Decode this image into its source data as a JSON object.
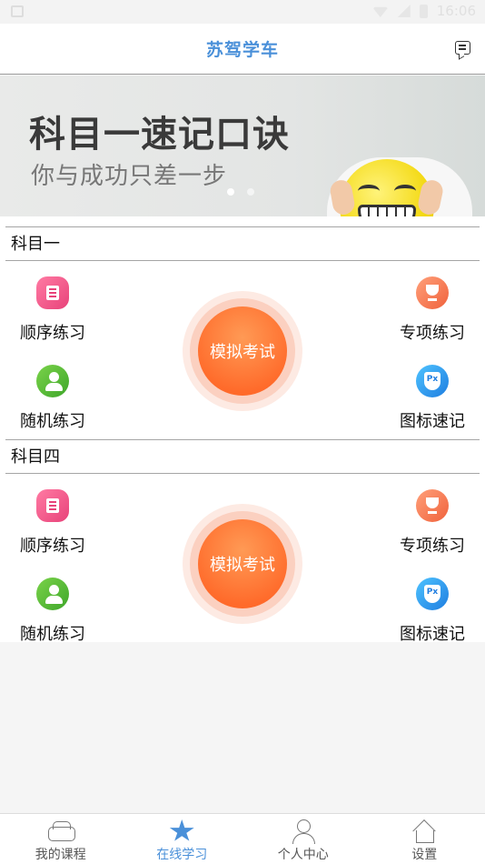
{
  "status_bar": {
    "time": "16:06"
  },
  "header": {
    "title": "苏驾学车",
    "message_icon": "message-icon"
  },
  "banner": {
    "headline": "科目一速记口诀",
    "subline": "你与成功只差一步",
    "carousel_count": 2,
    "active_index": 0
  },
  "sections": [
    {
      "title": "科目一",
      "items": {
        "sequential": "顺序练习",
        "special": "专项练习",
        "random": "随机练习",
        "icons": "图标速记"
      },
      "exam_label": "模拟考试"
    },
    {
      "title": "科目四",
      "items": {
        "sequential": "顺序练习",
        "special": "专项练习",
        "random": "随机练习",
        "icons": "图标速记"
      },
      "exam_label": "模拟考试"
    }
  ],
  "tabbar": {
    "tabs": [
      {
        "label": "我的课程",
        "icon": "car-icon",
        "active": false
      },
      {
        "label": "在线学习",
        "icon": "star-icon",
        "active": true
      },
      {
        "label": "个人中心",
        "icon": "user-icon",
        "active": false
      },
      {
        "label": "设置",
        "icon": "home-icon",
        "active": false
      }
    ]
  },
  "colors": {
    "accent": "#4a90d9",
    "exam": "#ff6a2a"
  }
}
